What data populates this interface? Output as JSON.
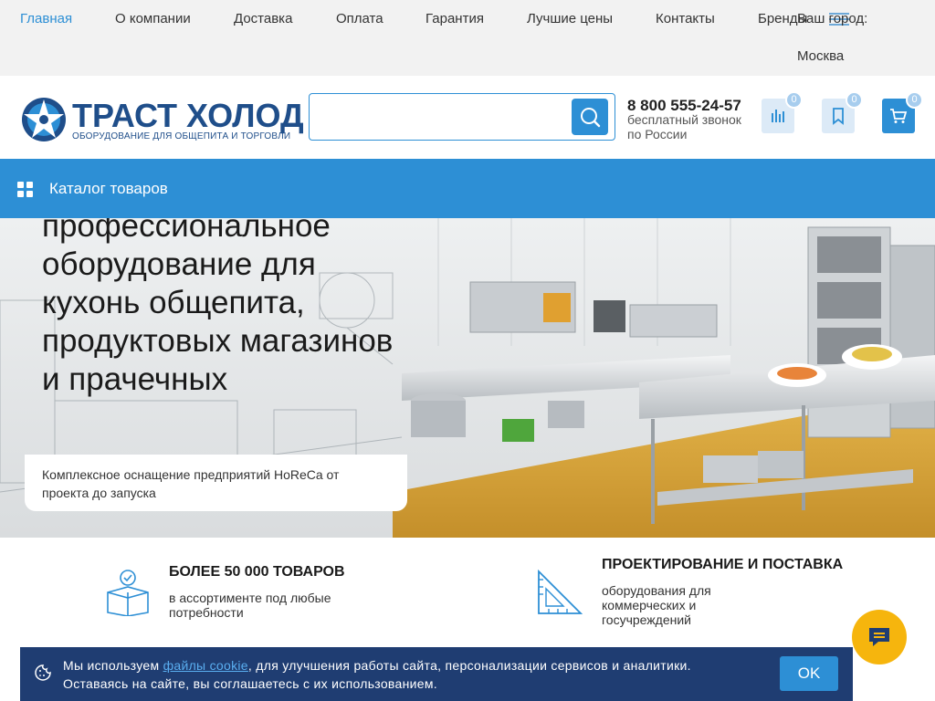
{
  "topnav": {
    "items": [
      "Главная",
      "О компании",
      "Доставка",
      "Оплата",
      "Гарантия",
      "Лучшие цены",
      "Контакты",
      "Бренды"
    ],
    "city_label": "Ваш город:",
    "city": "Москва"
  },
  "header": {
    "logo_name": "ТРАСТ ХОЛОД",
    "logo_sub": "ОБОРУДОВАНИЕ ДЛЯ ОБЩЕПИТА И ТОРГОВЛИ",
    "search": {
      "value": "",
      "placeholder": ""
    },
    "phone": "8 800 555-24-57",
    "phone_note": "бесплатный звонок по России",
    "compare_count": "0",
    "favorites_count": "0",
    "cart_count": "0"
  },
  "catalog": {
    "label": "Каталог товаров"
  },
  "hero": {
    "title": "профессиональное оборудование для кухонь общепита, продуктовых магазинов и прачечных",
    "subtitle": "Комплексное оснащение предприятий HoReCa от проекта до запуска"
  },
  "features": [
    {
      "title": "БОЛЕЕ 50 000 ТОВАРОВ",
      "text": "в ассортименте под любые потребности",
      "icon": "box-check-icon"
    },
    {
      "title": "ПРОЕКТИРОВАНИЕ И ПОСТАВКА",
      "text": "оборудования для коммерческих и госучреждений",
      "icon": "ruler-triangle-icon"
    }
  ],
  "cookie": {
    "text_before": "Мы используем ",
    "link": "файлы cookie",
    "text_after": ", для улучшения работы сайта, персонализации сервисов и аналитики.",
    "line2": "Оставаясь на сайте, вы соглашаетесь с их использованием.",
    "ok_label": "OK"
  },
  "colors": {
    "accent": "#2d8fd5",
    "brand": "#1f4e8a",
    "cookie_bg": "#1f3d72",
    "chat": "#f6b50d"
  }
}
